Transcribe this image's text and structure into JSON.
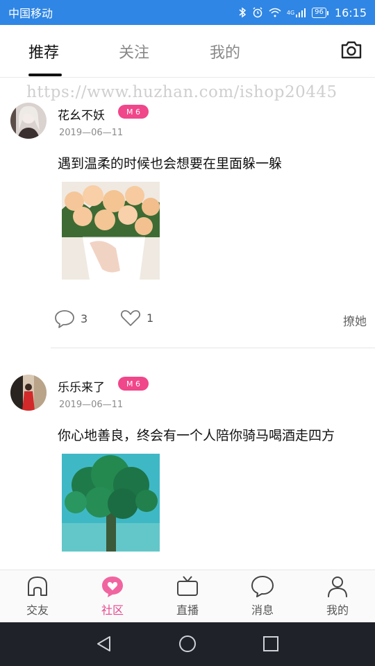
{
  "status_bar": {
    "carrier": "中国移动",
    "signal_type": "4G",
    "battery": "96",
    "time": "16:15",
    "background_color": "#2f86e4"
  },
  "top_tabs": [
    {
      "label": "推荐",
      "active": true
    },
    {
      "label": "关注",
      "active": false
    },
    {
      "label": "我的",
      "active": false
    }
  ],
  "top_icons": {
    "camera": "camera-icon"
  },
  "watermark": "https://www.huzhan.com/ishop20445",
  "posts": [
    {
      "username": "花幺不妖",
      "level": "M 6",
      "date": "2019—06—11",
      "content": "遇到温柔的时候也会想要在里面躲一躲",
      "image": "peach-roses-photo",
      "comments": "3",
      "likes": "1",
      "tease_label": "撩她"
    },
    {
      "username": "乐乐来了",
      "level": "M 6",
      "date": "2019—06—11",
      "content": "你心地善良，终会有一个人陪你骑马喝酒走四方",
      "image": "green-tree-illustration"
    }
  ],
  "bottom_nav": [
    {
      "label": "交友",
      "icon": "house-icon",
      "active": false
    },
    {
      "label": "社区",
      "icon": "heart-chat-icon",
      "active": true
    },
    {
      "label": "直播",
      "icon": "tv-icon",
      "active": false
    },
    {
      "label": "消息",
      "icon": "chat-bubble-icon",
      "active": false
    },
    {
      "label": "我的",
      "icon": "person-icon",
      "active": false
    }
  ],
  "accent_color": "#e8468d"
}
